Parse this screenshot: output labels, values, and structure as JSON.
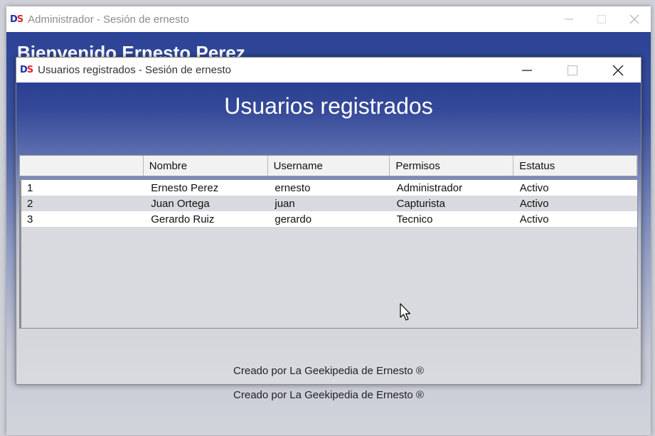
{
  "back_window": {
    "title": "Administrador - Sesión de ernesto",
    "heading": "Bienvenido Ernesto Perez",
    "footer": "Creado por La Geekipedia de Ernesto ®"
  },
  "front_window": {
    "title": "Usuarios registrados - Sesión de ernesto",
    "heading": "Usuarios registrados",
    "footer": "Creado por La Geekipedia de Ernesto ®",
    "table": {
      "columns": [
        "",
        "Nombre",
        "Username",
        "Permisos",
        "Estatus"
      ],
      "rows": [
        [
          "1",
          "Ernesto Perez",
          "ernesto",
          "Administrador",
          "Activo"
        ],
        [
          "2",
          "Juan Ortega",
          "juan",
          "Capturista",
          "Activo"
        ],
        [
          "3",
          "Gerardo Ruiz",
          "gerardo",
          "Tecnico",
          "Activo"
        ]
      ]
    }
  },
  "logo": {
    "d": "D",
    "s": "S"
  },
  "colors": {
    "logo_d": "#1e2ea8",
    "logo_s": "#e0262e",
    "header_blue": "#2b3f93"
  },
  "icons": [
    "app-logo-icon",
    "minimize-icon",
    "maximize-icon",
    "close-icon",
    "mouse-cursor-icon"
  ]
}
